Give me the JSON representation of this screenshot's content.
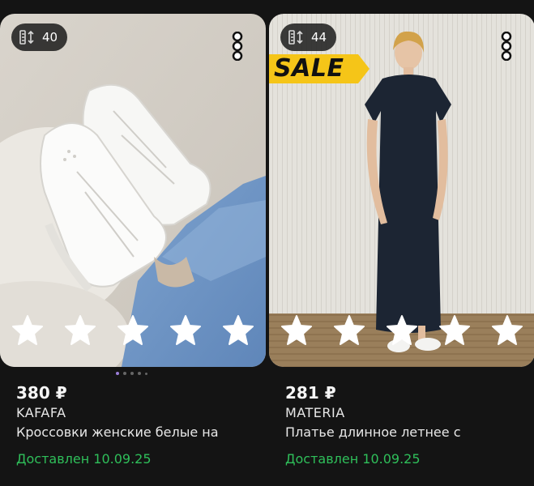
{
  "products": [
    {
      "size_count": "40",
      "price": "380 ₽",
      "brand": "KAFAFA",
      "title": "Кроссовки женские белые на",
      "delivery": "Доставлен 10.09.25",
      "rating_stars": 5,
      "carousel_pages": 5,
      "carousel_active": 1
    },
    {
      "size_count": "44",
      "sale_label": "SALE",
      "price": "281 ₽",
      "brand": "MATERIA",
      "title": "Платье длинное летнее с",
      "delivery": "Доставлен 10.09.25",
      "rating_stars": 5
    }
  ],
  "icons": {
    "size": "ruler-arrows-icon",
    "more": "vertical-dots-icon",
    "star": "star-outline-icon"
  },
  "colors": {
    "background": "#141414",
    "delivery": "#2fbf5a",
    "sale_badge": "#f5c518",
    "carousel_active": "#9b7ed8"
  }
}
